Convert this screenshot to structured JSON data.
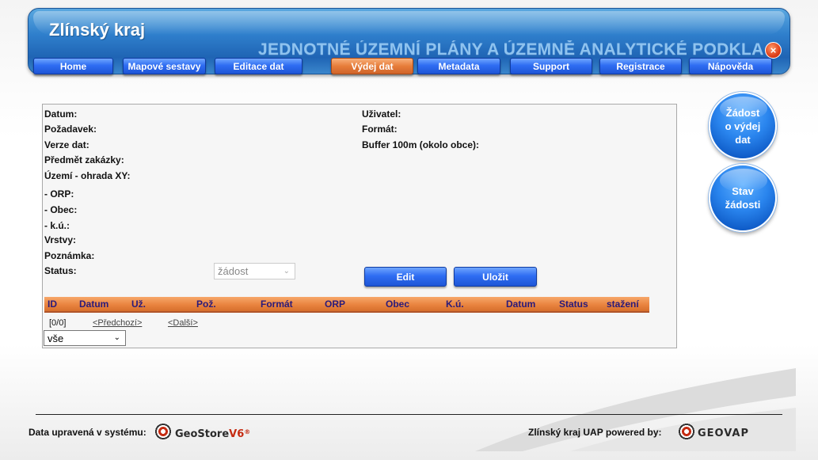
{
  "header": {
    "title": "Zlínský kraj",
    "subtitle": "JEDNOTNÉ ÚZEMNÍ PLÁNY A  ÚZEMNĚ ANALYTICKÉ PODKLADY",
    "close_glyph": "×"
  },
  "nav": {
    "items": [
      {
        "label": "Home"
      },
      {
        "label": "Mapové sestavy"
      },
      {
        "label": "Editace dat"
      },
      {
        "label": "Výdej dat",
        "active": true
      },
      {
        "label": "Metadata"
      },
      {
        "label": "Support"
      },
      {
        "label": "Registrace"
      },
      {
        "label": "Nápověda"
      }
    ]
  },
  "form": {
    "left_labels": [
      "Datum:",
      "Požadavek:",
      "Verze dat:",
      "Předmět zakázky:",
      "Území - ohrada XY:",
      "- ORP:",
      "- Obec:",
      "- k.ú.:",
      "Vrstvy:",
      "Poznámka:",
      "Status:"
    ],
    "right_labels": [
      "Uživatel:",
      "Formát:",
      "Buffer 100m (okolo obce):"
    ],
    "status_select": {
      "value": "žádost"
    },
    "edit_label": "Edit",
    "save_label": "Uložit"
  },
  "grid": {
    "columns": [
      "ID",
      "Datum",
      "Už.",
      "Pož.",
      "Formát",
      "ORP",
      "Obec",
      "K.ú.",
      "Datum",
      "Status",
      "stažení"
    ],
    "pager_count": "[0/0]",
    "prev_label": "<Předchozí>",
    "next_label": "<Další>",
    "filter_select": {
      "value": "vše"
    }
  },
  "side_buttons": {
    "request": {
      "line1": "Žádost",
      "line2": "o výdej",
      "line3": "dat"
    },
    "status": {
      "line1": "Stav",
      "line2": "žádosti"
    }
  },
  "footer": {
    "left_text": "Data upravená v systému:",
    "left_logo_a": "GeoStore",
    "left_logo_b": "V6",
    "left_logo_mark": "®",
    "right_text": "Zlínský kraj UAP powered by:",
    "right_logo": "GEOVAP"
  },
  "colors": {
    "banner": "#2f7fcc",
    "nav_tab": "#2f6df2",
    "nav_active": "#e67d3a",
    "grid_header": "#e9843f",
    "grid_header_text": "#2a1a7a"
  }
}
